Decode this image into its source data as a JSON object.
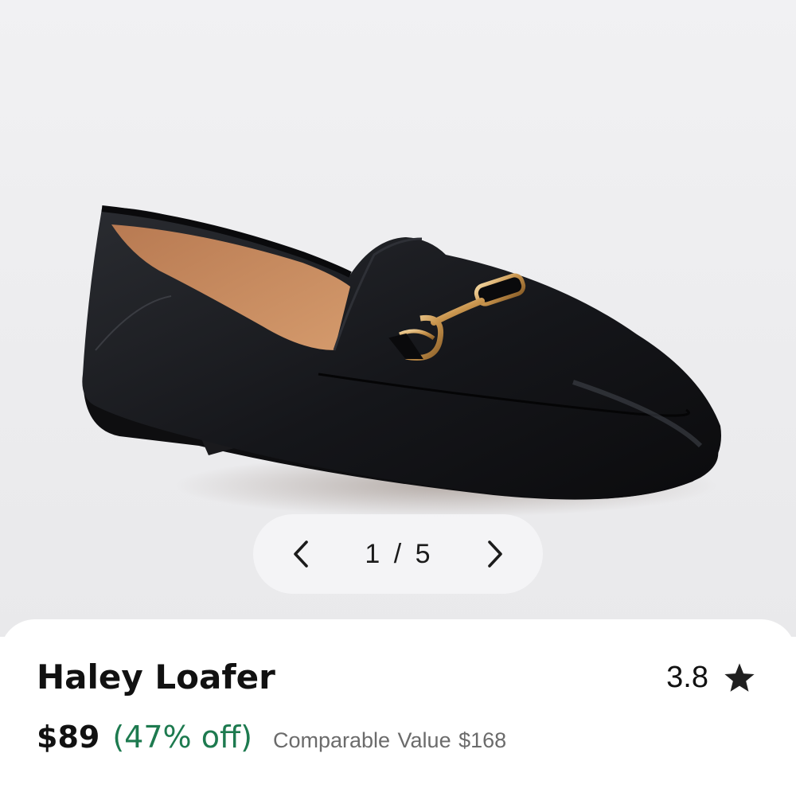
{
  "product": {
    "name": "Haley Loafer",
    "rating": "3.8",
    "price": "$89",
    "discount": "(47% off)",
    "comparable_label": "Comparable Value",
    "comparable_price": "$168"
  },
  "gallery": {
    "counter": "1 / 5",
    "prev_icon": "chevron-left-icon",
    "next_icon": "chevron-right-icon"
  },
  "colors": {
    "discount": "#1d7a4f",
    "text": "#111111",
    "muted": "#6b6b6b"
  }
}
